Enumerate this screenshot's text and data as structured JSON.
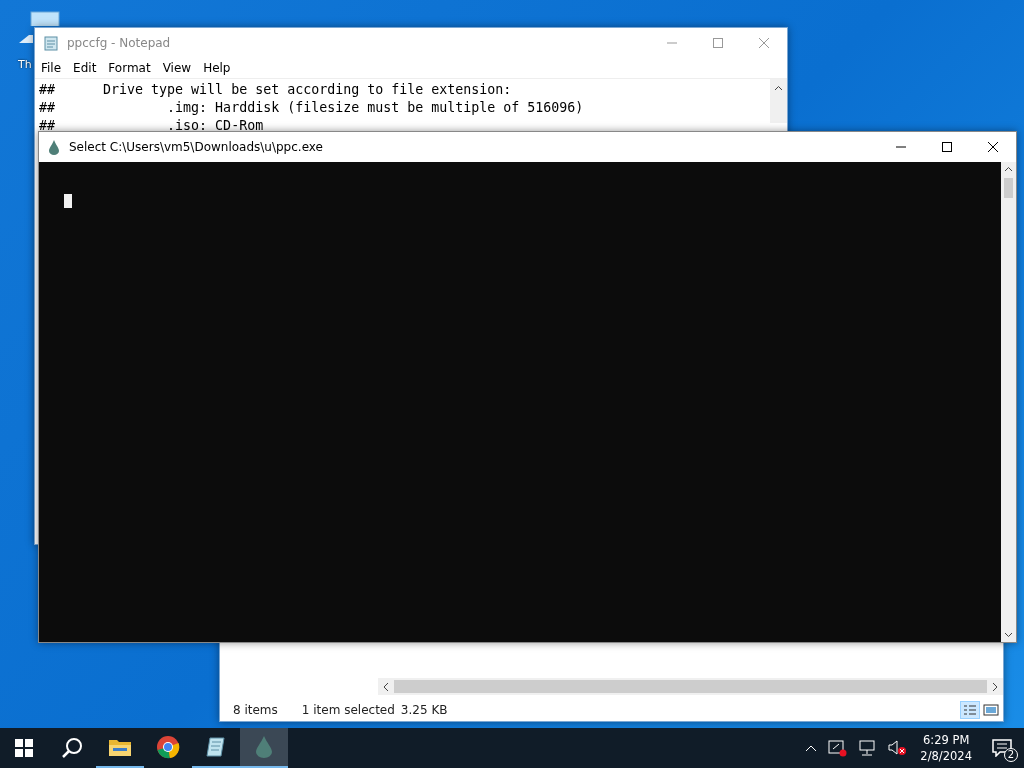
{
  "desktop_icon": {
    "label": "Th"
  },
  "notepad": {
    "title": "ppccfg - Notepad",
    "menu": [
      "File",
      "Edit",
      "Format",
      "View",
      "Help"
    ],
    "lines": [
      "##      Drive type will be set according to file extension:",
      "##              .img: Harddisk (filesize must be multiple of 516096)",
      "##              .iso: CD-Rom"
    ]
  },
  "explorer": {
    "status": [
      "8 items",
      "1 item selected",
      "3.25 KB"
    ]
  },
  "console": {
    "title": "Select C:\\Users\\vm5\\Downloads\\u\\ppc.exe"
  },
  "taskbar": {
    "apps": [
      {
        "kind": "folder",
        "running": true,
        "selected": false
      },
      {
        "kind": "browser",
        "running": false,
        "selected": false
      },
      {
        "kind": "notepad",
        "running": true,
        "selected": false
      },
      {
        "kind": "console",
        "running": true,
        "selected": true
      }
    ],
    "time": "6:29 PM",
    "date": "2/8/2024",
    "notifications": "2"
  }
}
